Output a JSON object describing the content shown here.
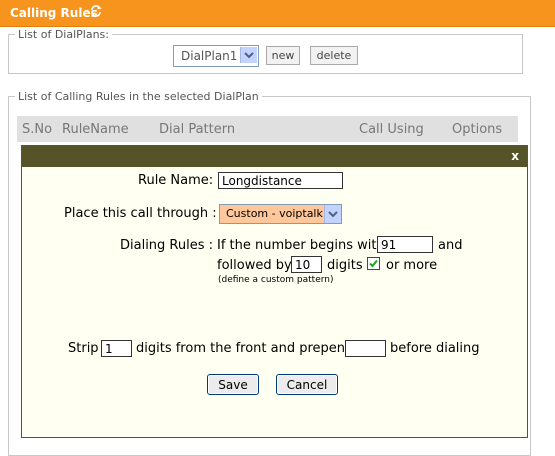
{
  "header": {
    "title": "Calling Rules",
    "refresh_icon": "refresh-icon"
  },
  "dialplans": {
    "legend": "List of DialPlans:",
    "selected": "DialPlan1",
    "new_label": "new",
    "delete_label": "delete"
  },
  "rules": {
    "legend": "List of Calling Rules in the selected DialPlan",
    "columns": [
      "S.No",
      "RuleName",
      "Dial Pattern",
      "Call Using",
      "Options"
    ]
  },
  "dialog": {
    "close_label": "x",
    "rule_name_label": "Rule Name:",
    "rule_name_value": "Longdistance",
    "place_call_label": "Place this call through :",
    "trunk_value": "Custom - voiptalk",
    "dialing_rules_label": "Dialing Rules :",
    "begins_with_text": "If the number begins with",
    "begins_with_value": "91",
    "and_text": "and",
    "followed_by_text": "followed by",
    "followed_by_value": "10",
    "digits_text": "digits",
    "or_more_text": "or more",
    "or_more_checked": true,
    "custom_pattern_text": "(define a custom pattern)",
    "strip_text": "Strip",
    "strip_value": "1",
    "front_prepend_text": "digits from the front and prepend",
    "prepend_value": "",
    "before_dialing_text": "before dialing",
    "save_label": "Save",
    "cancel_label": "Cancel"
  }
}
